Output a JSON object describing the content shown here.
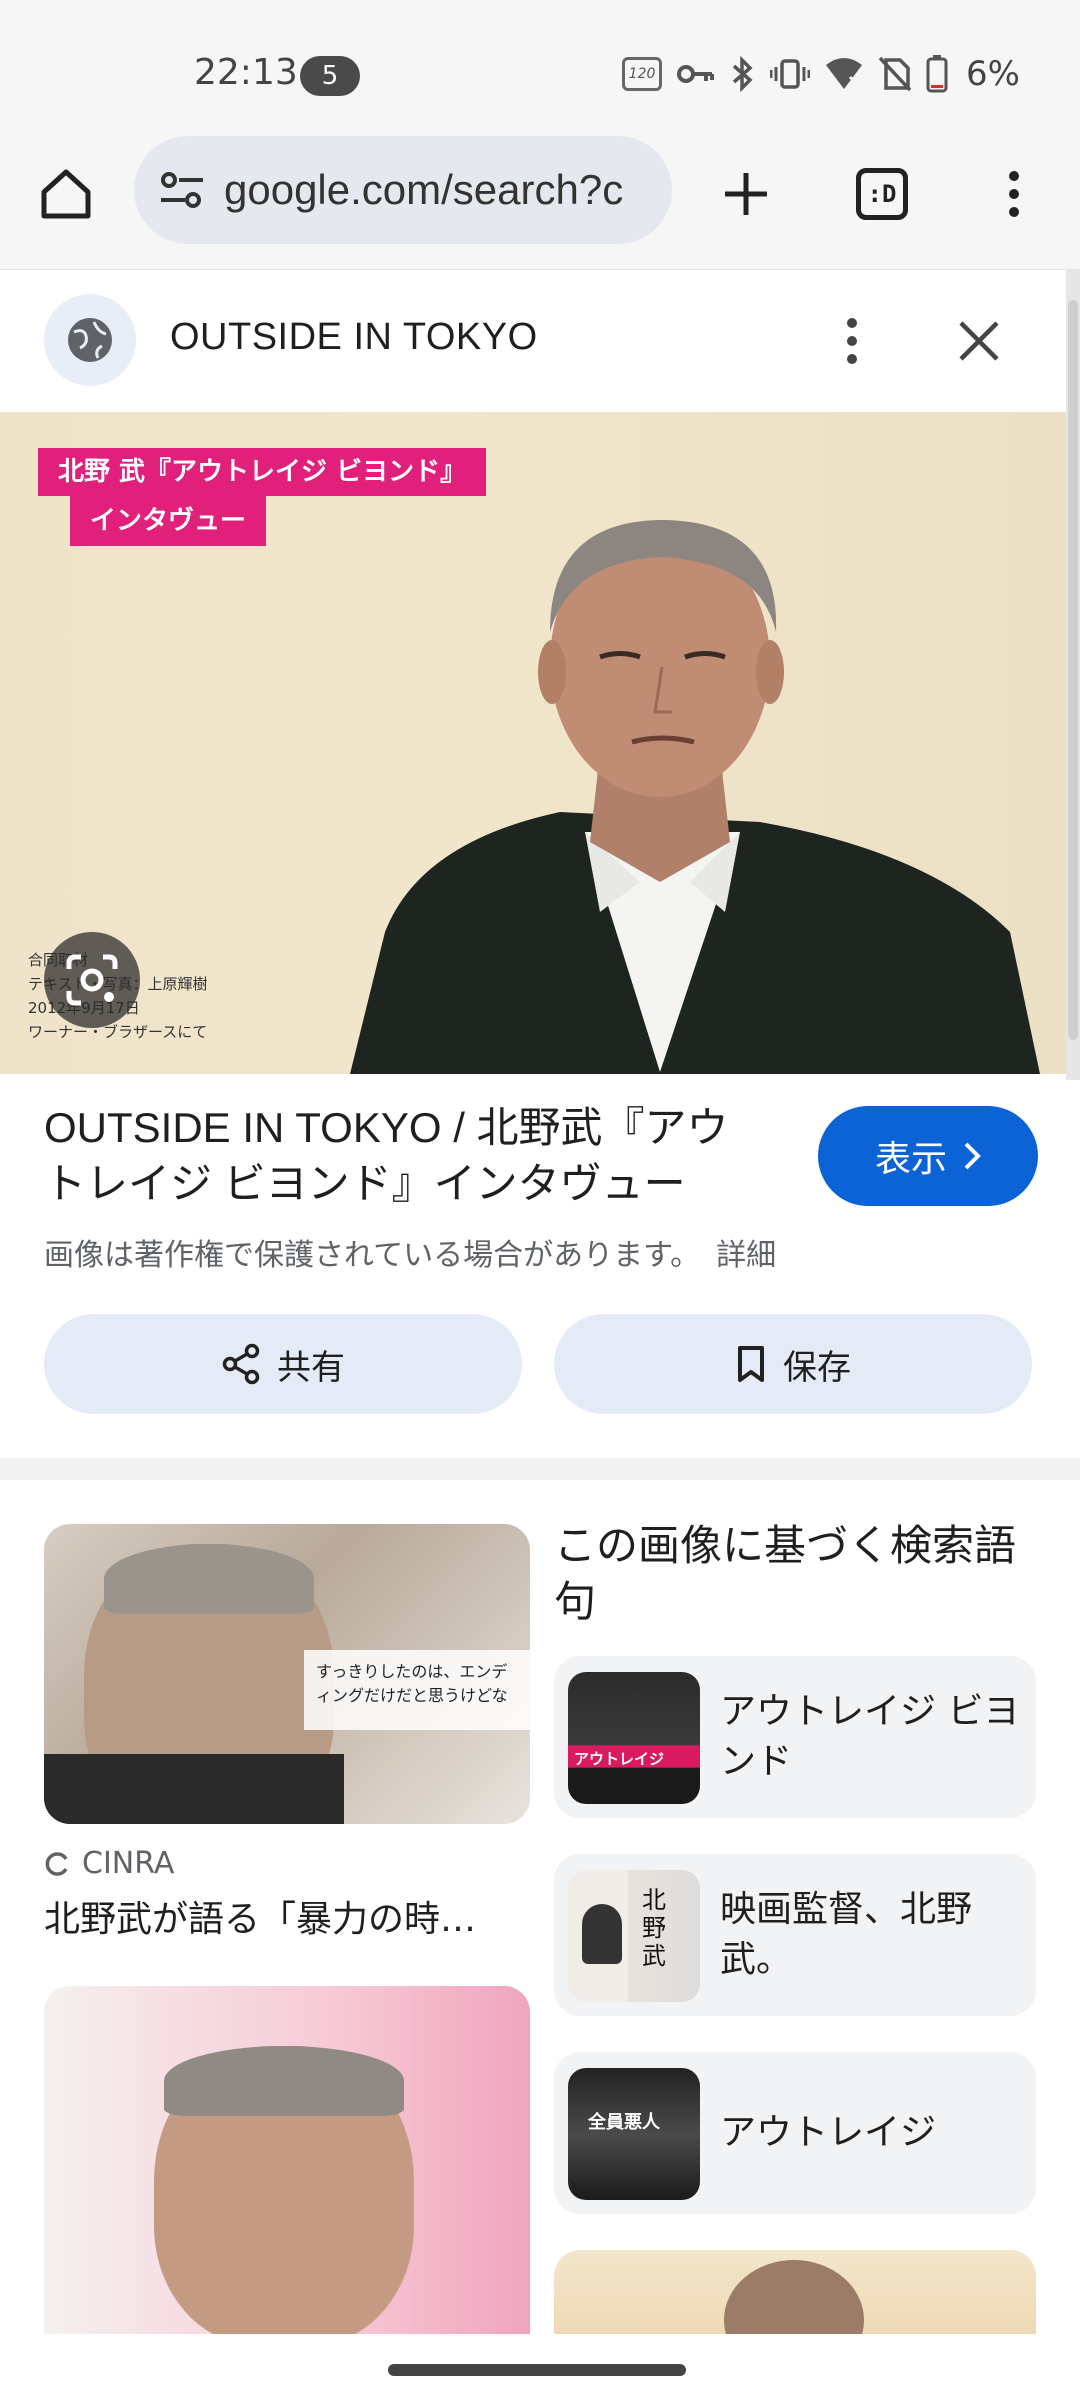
{
  "status_bar": {
    "time": "22:13",
    "notification_count": "5",
    "refresh_rate": "120",
    "battery": "6%"
  },
  "toolbar": {
    "url": "google.com/search?c",
    "tab_label": ":D"
  },
  "panel": {
    "site_name": "OUTSIDE IN TOKYO"
  },
  "hero": {
    "tag_line1": "北野 武『アウトレイジ ビヨンド』",
    "tag_line2": "インタヴュー",
    "credit_line1": "合同取材",
    "credit_line2": "テキスト・写真：上原輝樹",
    "credit_line3": "2012年9月17日",
    "credit_line4": "ワーナー・ブラザースにて"
  },
  "result": {
    "title": "OUTSIDE IN TOKYO / 北野武『アウトレイジ ビヨンド』インタヴュー",
    "visit_label": "表示",
    "copyright_notice": "画像は著作権で保護されている場合があります。",
    "details_link": "詳細",
    "share_label": "共有",
    "save_label": "保存"
  },
  "related": {
    "thumb_caption": "すっきりしたのは、エンディングだけだと思うけどな",
    "source_name": "CINRA",
    "caption": "北野武が語る「暴力の時…",
    "heading": "この画像に基づく検索語句",
    "terms": [
      {
        "label": "アウトレイジ ビヨンド",
        "image_text": "アウトレイジ"
      },
      {
        "label": "映画監督、北野武。",
        "image_text": "北野武"
      },
      {
        "label": "アウトレイジ",
        "image_text": "全員悪人"
      }
    ]
  },
  "colors": {
    "accent_blue": "#0b63d6",
    "pill_background": "#e5ebf6",
    "hero_tag_pink": "#e0207a"
  }
}
